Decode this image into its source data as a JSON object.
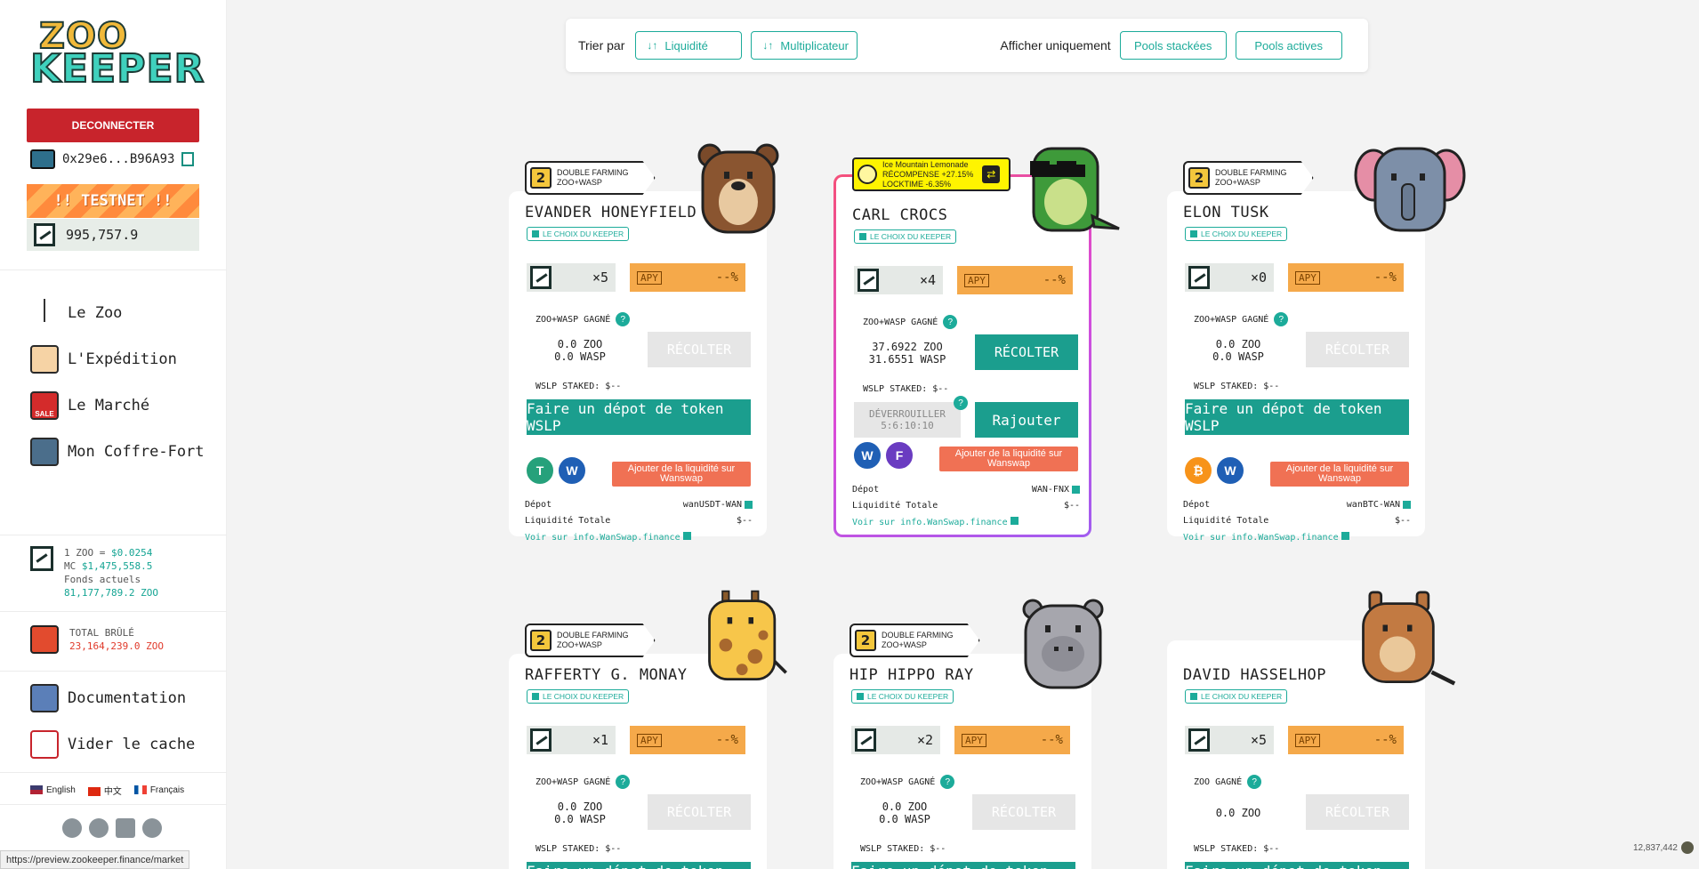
{
  "sidebar": {
    "logo": {
      "line1": "ZOO",
      "line2": "KEEPER"
    },
    "disconnect_label": "DECONNECTER",
    "address": "0x29e6...B96A93",
    "testnet_label": "!! TESTNET !!",
    "balance": "995,757.9",
    "nav": [
      {
        "label": "Le Zoo",
        "icon": "zoo-icon"
      },
      {
        "label": "L'Expédition",
        "icon": "expedition-icon"
      },
      {
        "label": "Le Marché",
        "icon": "sale-icon"
      },
      {
        "label": "Mon Coffre-Fort",
        "icon": "safe-icon"
      }
    ],
    "price": {
      "label": "1 ZOO =",
      "value": "$0.0254",
      "mc_label": "MC",
      "mc_value": "$1,475,558.5",
      "funds_label": "Fonds actuels",
      "funds_value": "81,177,789.2 ZOO"
    },
    "burn": {
      "label": "TOTAL BRÛLÉ",
      "value": "23,164,239.0 ZOO"
    },
    "bottom_nav": [
      {
        "label": "Documentation",
        "icon": "documentation-icon"
      },
      {
        "label": "Vider le cache",
        "icon": "clear-cache-icon"
      }
    ],
    "languages": [
      "English",
      "中文",
      "Français"
    ],
    "social": [
      "twitter-icon",
      "telegram-icon",
      "medium-icon",
      "github-icon"
    ]
  },
  "status_url": "https://preview.zookeeper.finance/market",
  "corner_value": "12,837,442",
  "toolbar": {
    "sort_label": "Trier par",
    "sort_liquidity": "Liquidité",
    "sort_multiplier": "Multiplicateur",
    "show_only_label": "Afficher uniquement",
    "filter_staked": "Pools stackées",
    "filter_active": "Pools actives"
  },
  "common": {
    "keeper_choice": "LE CHOIX DU KEEPER",
    "apy_badge": "APY",
    "apy_value": "--%",
    "harvest": "RÉCOLTER",
    "deposit": "Faire un dépot de token WSLP",
    "add_liquidity": "Ajouter de la liquidité sur Wanswap",
    "depot_label": "Dépot",
    "total_liq_label": "Liquidité Totale",
    "total_liq_value": "$--",
    "info_link": "Voir sur info.WanSwap.finance",
    "staked": "WSLP STAKED: $--",
    "double_farming": "DOUBLE FARMING",
    "double_pair": "ZOO+WASP"
  },
  "pools": [
    {
      "name": "EVANDER HONEYFIELD",
      "mult": "×5",
      "earned": "ZOO+WASP GAGNÉ",
      "amt1": "0.0 ZOO",
      "amt2": "0.0 WASP",
      "depot": "wanUSDT-WAN"
    },
    {
      "name": "CARL CROCS",
      "mult": "×4",
      "earned": "ZOO+WASP GAGNÉ",
      "amt1": "37.6922 ZOO",
      "amt2": "31.6551 WASP",
      "depot": "WAN-FNX",
      "boost": {
        "line1": "Ice Mountain Lemonade",
        "line2": "RÉCOMPENSE +27.15%",
        "line3": "LOCKTIME -6.35%"
      },
      "unlock": {
        "line1": "DÉVERROUILLER",
        "line2": "5:6:10:10"
      },
      "add_more": "Rajouter"
    },
    {
      "name": "ELON TUSK",
      "mult": "×0",
      "earned": "ZOO+WASP GAGNÉ",
      "amt1": "0.0 ZOO",
      "amt2": "0.0 WASP",
      "depot": "wanBTC-WAN"
    },
    {
      "name": "RAFFERTY G. MONAY",
      "mult": "×1",
      "earned": "ZOO+WASP GAGNÉ",
      "amt1": "0.0 ZOO",
      "amt2": "0.0 WASP"
    },
    {
      "name": "HIP HIPPO RAY",
      "mult": "×2",
      "earned": "ZOO+WASP GAGNÉ",
      "amt1": "0.0 ZOO",
      "amt2": "0.0 WASP"
    },
    {
      "name": "DAVID HASSELHOP",
      "mult": "×5",
      "earned": "ZOO GAGNÉ",
      "amt1": "0.0 ZOO",
      "amt2": ""
    }
  ]
}
